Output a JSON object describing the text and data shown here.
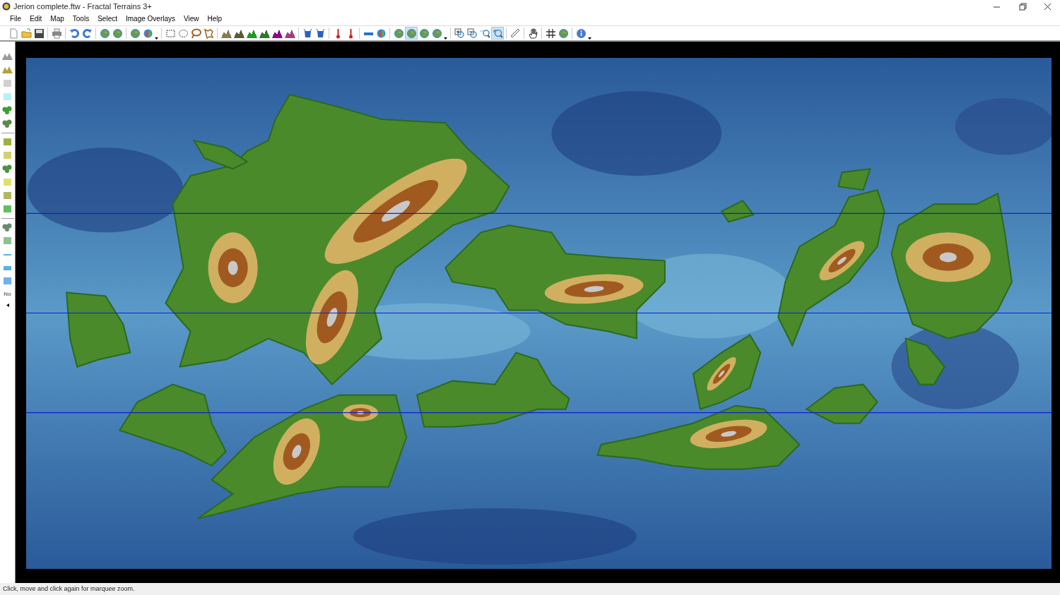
{
  "window": {
    "title": "Jerion complete.ftw - Fractal Terrains 3+"
  },
  "menu": [
    "File",
    "Edit",
    "Map",
    "Tools",
    "Select",
    "Image Overlays",
    "View",
    "Help"
  ],
  "toolbar": [
    [
      {
        "kind": "new",
        "selected": false
      },
      {
        "kind": "open",
        "selected": false
      },
      {
        "kind": "save",
        "selected": false
      }
    ],
    [
      {
        "kind": "print",
        "selected": false
      }
    ],
    [
      {
        "kind": "undo",
        "selected": false
      },
      {
        "kind": "redo",
        "selected": false
      }
    ],
    [
      {
        "kind": "globe",
        "selected": false
      },
      {
        "kind": "globe",
        "selected": false
      }
    ],
    [
      {
        "kind": "globe",
        "selected": false
      },
      {
        "kind": "globe-color",
        "selected": false,
        "dropdown": true
      }
    ],
    [
      {
        "kind": "rect-select",
        "selected": false
      },
      {
        "kind": "ellipse-select",
        "selected": false
      },
      {
        "kind": "lasso",
        "selected": false
      },
      {
        "kind": "poly-lasso",
        "selected": false
      }
    ],
    [
      {
        "kind": "mountain",
        "color": "#8a7a50",
        "selected": false
      },
      {
        "kind": "mountain",
        "color": "#5a5a3a",
        "selected": false
      },
      {
        "kind": "mountain",
        "color": "#1f9a1f",
        "selected": false
      },
      {
        "kind": "mountain",
        "color": "#2a7a2a",
        "selected": false
      },
      {
        "kind": "mountain",
        "color": "#8a0a8a",
        "selected": false
      },
      {
        "kind": "mountain",
        "color": "#a04080",
        "selected": false
      }
    ],
    [
      {
        "kind": "bucket",
        "selected": false
      },
      {
        "kind": "bucket",
        "selected": false
      }
    ],
    [
      {
        "kind": "thermometer",
        "selected": false
      },
      {
        "kind": "thermometer",
        "selected": false
      }
    ],
    [
      {
        "kind": "bar",
        "selected": false
      },
      {
        "kind": "globe-color",
        "selected": false
      }
    ],
    [
      {
        "kind": "globe",
        "selected": false
      },
      {
        "kind": "globe",
        "selected": true
      },
      {
        "kind": "globe",
        "selected": false
      },
      {
        "kind": "globe",
        "selected": false,
        "dropdown": true
      }
    ],
    [
      {
        "kind": "zoom-in",
        "selected": false
      },
      {
        "kind": "zoom-out",
        "selected": false
      },
      {
        "kind": "zoom-back",
        "selected": false
      },
      {
        "kind": "zoom",
        "selected": true
      }
    ],
    [
      {
        "kind": "ruler",
        "selected": false
      }
    ],
    [
      {
        "kind": "hand",
        "selected": false
      }
    ],
    [
      {
        "kind": "grid",
        "selected": false
      },
      {
        "kind": "globe",
        "selected": false
      }
    ],
    [
      {
        "kind": "info",
        "selected": false,
        "dropdown": true
      }
    ]
  ],
  "palette": [
    {
      "kind": "peaks",
      "color": "#9a9a9a"
    },
    {
      "kind": "peaks",
      "color": "#b8a040"
    },
    {
      "kind": "tile",
      "color": "#d0d0d0"
    },
    {
      "kind": "tile",
      "color": "#b8f0f8"
    },
    {
      "kind": "trees",
      "color": "#3aa030"
    },
    {
      "kind": "trees",
      "color": "#5a8a50"
    },
    {
      "kind": "separator"
    },
    {
      "kind": "tile",
      "color": "#a0b040"
    },
    {
      "kind": "tile",
      "color": "#d8d070"
    },
    {
      "kind": "trees",
      "color": "#4a9040"
    },
    {
      "kind": "tile",
      "color": "#e0e070"
    },
    {
      "kind": "tile",
      "color": "#b0b860"
    },
    {
      "kind": "tile",
      "color": "#60c060"
    },
    {
      "kind": "separator"
    },
    {
      "kind": "trees",
      "color": "#6a8a6a"
    },
    {
      "kind": "tile",
      "color": "#90c090"
    },
    {
      "kind": "line",
      "color": "#5ab0e8"
    },
    {
      "kind": "water",
      "color": "#5ab0e8"
    },
    {
      "kind": "tile",
      "color": "#70b0f0"
    },
    {
      "kind": "text",
      "label": "No"
    },
    {
      "kind": "arrow"
    }
  ],
  "status_bar": "Click, move and click again for marquee zoom."
}
